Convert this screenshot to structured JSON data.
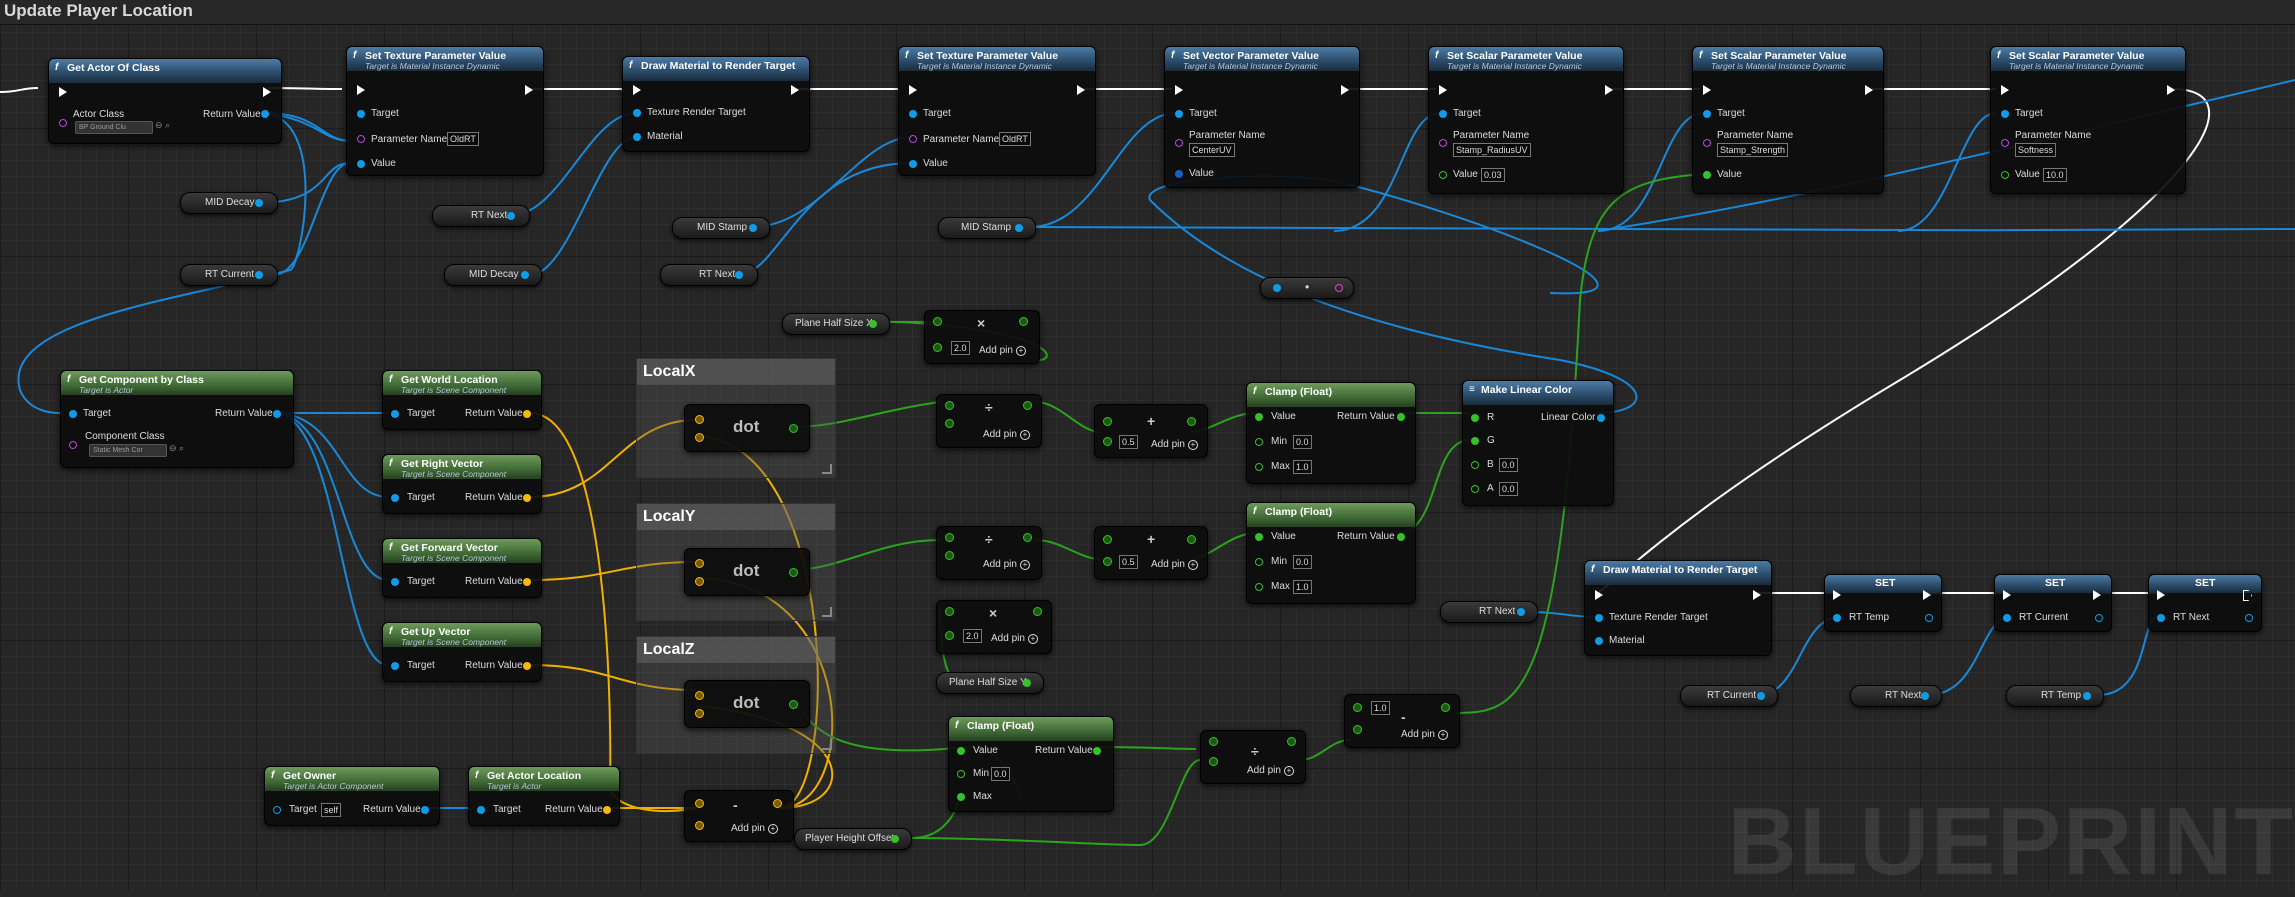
{
  "graph": {
    "title": "Update Player Location",
    "watermark": "BLUEPRINT"
  },
  "colors": {
    "exec": "#ffffff",
    "object": "#0e9be8",
    "vector": "#f5b90a",
    "float": "#36c02a",
    "class": "#b64bd6",
    "header_function": "#4c7ba6",
    "header_pure": "#6e9a5a"
  },
  "nodes": {
    "get_actor_of_class": {
      "title": "Get Actor Of Class",
      "pin_actor_class": "Actor Class",
      "actor_class_value": "BP Ground Clu",
      "pin_return": "Return Value"
    },
    "set_tex_1": {
      "title": "Set Texture Parameter Value",
      "subtitle": "Target is Material Instance Dynamic",
      "pin_target": "Target",
      "pin_param": "Parameter Name",
      "param_value": "OldRT",
      "pin_value": "Value"
    },
    "draw_mat_1": {
      "title": "Draw Material to Render Target",
      "pin_trt": "Texture Render Target",
      "pin_material": "Material"
    },
    "set_tex_2": {
      "title": "Set Texture Parameter Value",
      "subtitle": "Target is Material Instance Dynamic",
      "pin_target": "Target",
      "pin_param": "Parameter Name",
      "param_value": "OldRT",
      "pin_value": "Value"
    },
    "set_vec": {
      "title": "Set Vector Parameter Value",
      "subtitle": "Target is Material Instance Dynamic",
      "pin_target": "Target",
      "pin_param": "Parameter Name",
      "param_value": "CenterUV",
      "pin_value": "Value"
    },
    "set_scalar_1": {
      "title": "Set Scalar Parameter Value",
      "subtitle": "Target is Material Instance Dynamic",
      "pin_target": "Target",
      "pin_param": "Parameter Name",
      "param_value": "Stamp_RadiusUV",
      "pin_value": "Value",
      "value": "0.03"
    },
    "set_scalar_2": {
      "title": "Set Scalar Parameter Value",
      "subtitle": "Target is Material Instance Dynamic",
      "pin_target": "Target",
      "pin_param": "Parameter Name",
      "param_value": "Stamp_Strength",
      "pin_value": "Value"
    },
    "set_scalar_3": {
      "title": "Set Scalar Parameter Value",
      "subtitle": "Target is Material Instance Dynamic",
      "pin_target": "Target",
      "pin_param": "Parameter Name",
      "param_value": "Softness",
      "pin_value": "Value",
      "value": "10.0"
    },
    "get_component": {
      "title": "Get Component by Class",
      "subtitle": "Target is Actor",
      "pin_target": "Target",
      "pin_return": "Return Value",
      "pin_class": "Component Class",
      "class_value": "Static Mesh Cor"
    },
    "get_world_loc": {
      "title": "Get World Location",
      "subtitle": "Target is Scene Component",
      "pin_target": "Target",
      "pin_return": "Return Value"
    },
    "get_right": {
      "title": "Get Right Vector",
      "subtitle": "Target is Scene Component",
      "pin_target": "Target",
      "pin_return": "Return Value"
    },
    "get_forward": {
      "title": "Get Forward Vector",
      "subtitle": "Target is Scene Component",
      "pin_target": "Target",
      "pin_return": "Return Value"
    },
    "get_up": {
      "title": "Get Up Vector",
      "subtitle": "Target is Scene Component",
      "pin_target": "Target",
      "pin_return": "Return Value"
    },
    "get_owner": {
      "title": "Get Owner",
      "subtitle": "Target is Actor Component",
      "pin_target": "Target",
      "target_value": "self",
      "pin_return": "Return Value"
    },
    "get_actor_loc": {
      "title": "Get Actor Location",
      "subtitle": "Target is Actor",
      "pin_target": "Target",
      "pin_return": "Return Value"
    },
    "clamp_1": {
      "title": "Clamp (Float)",
      "pin_value": "Value",
      "pin_return": "Return Value",
      "pin_min": "Min",
      "min": "0.0",
      "pin_max": "Max",
      "max": "1.0"
    },
    "clamp_2": {
      "title": "Clamp (Float)",
      "pin_value": "Value",
      "pin_return": "Return Value",
      "pin_min": "Min",
      "min": "0.0",
      "pin_max": "Max",
      "max": "1.0"
    },
    "clamp_3": {
      "title": "Clamp (Float)",
      "pin_value": "Value",
      "pin_return": "Return Value",
      "pin_min": "Min",
      "min": "0.0",
      "pin_max": "Max"
    },
    "make_color": {
      "title": "Make Linear Color",
      "pin_r": "R",
      "pin_g": "G",
      "pin_b": "B",
      "b": "0.0",
      "pin_a": "A",
      "a": "0.0",
      "pin_out": "Linear Color"
    },
    "draw_mat_2": {
      "title": "Draw Material to Render Target",
      "pin_trt": "Texture Render Target",
      "pin_material": "Material"
    },
    "set_1": {
      "title": "SET",
      "pin": "RT Temp"
    },
    "set_2": {
      "title": "SET",
      "pin": "RT Current"
    },
    "set_3": {
      "title": "SET",
      "pin": "RT Next"
    }
  },
  "math": {
    "mul_x": {
      "value": "2.0",
      "add": "Add pin"
    },
    "div_x": {
      "add": "Add pin"
    },
    "add_x": {
      "value": "0.5",
      "add": "Add pin"
    },
    "div_y": {
      "add": "Add pin"
    },
    "add_y": {
      "value": "0.5",
      "add": "Add pin"
    },
    "mul_y": {
      "value": "2.0",
      "add": "Add pin"
    },
    "sub_h": {
      "add": "Add pin"
    },
    "div_h": {
      "add": "Add pin"
    },
    "sub_1": {
      "value": "1.0",
      "add": "Add pin"
    },
    "dot_x": "dot",
    "dot_y": "dot",
    "dot_z": "dot"
  },
  "comments": {
    "localx": "LocalX",
    "localy": "LocalY",
    "localz": "LocalZ"
  },
  "vars": {
    "mid_decay_1": "MID Decay",
    "rt_current_1": "RT Current",
    "rt_next_1": "RT Next",
    "mid_decay_2": "MID Decay",
    "mid_stamp_1": "MID Stamp",
    "rt_next_2": "RT Next",
    "mid_stamp_2": "MID Stamp",
    "plane_half_x": "Plane Half Size X",
    "plane_half_y": "Plane Half Size Y",
    "player_height": "Player Height Offset",
    "rt_next_3": "RT Next",
    "rt_current_2": "RT Current",
    "rt_next_4": "RT Next",
    "rt_temp": "RT Temp"
  }
}
